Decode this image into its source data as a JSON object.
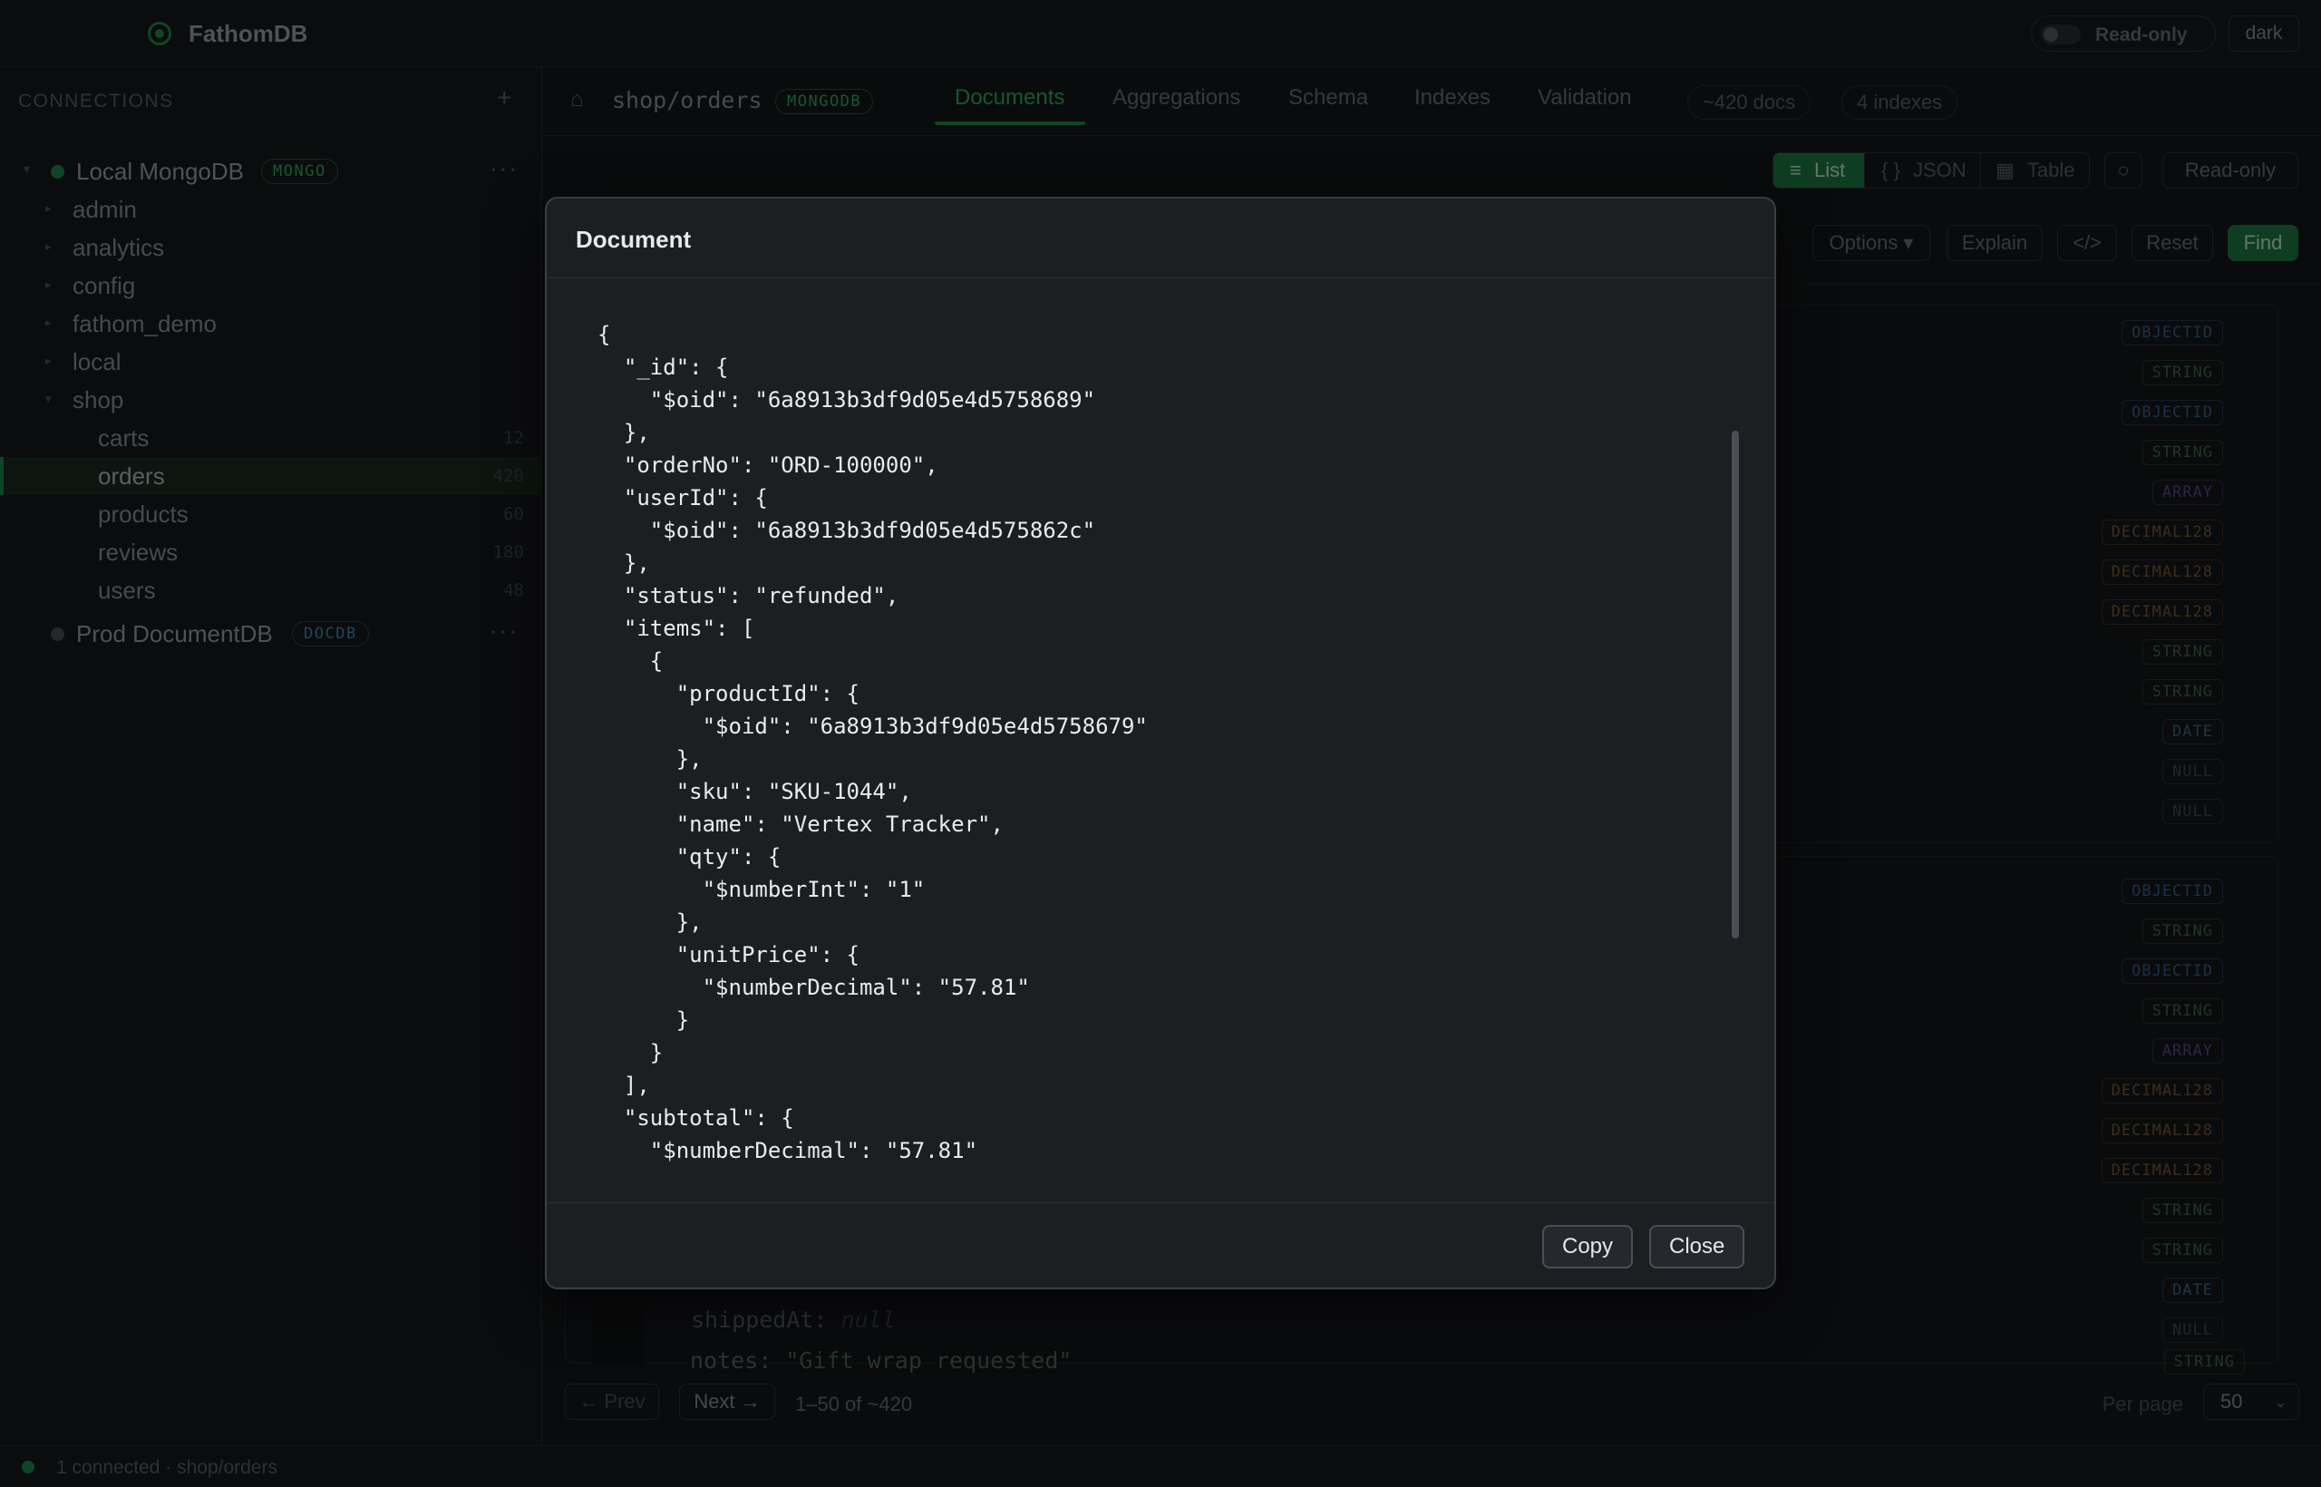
{
  "app": {
    "title": "FathomDB",
    "readonly_toggle": "Read-only",
    "theme": "dark"
  },
  "sidebar": {
    "header": "CONNECTIONS",
    "add": "+",
    "connections": [
      {
        "name": "Local MongoDB",
        "badge": "MONGO",
        "status_color": "#1f8a4c",
        "badge_color": "#2fae5e"
      },
      {
        "name": "Prod DocumentDB",
        "badge": "DOCDB",
        "status_color": "#4b4f55",
        "badge_color": "#3b8fb0"
      }
    ],
    "more": "···",
    "databases": [
      "admin",
      "analytics",
      "config",
      "fathom_demo",
      "local",
      "shop"
    ],
    "collections": [
      {
        "name": "carts",
        "count": "12"
      },
      {
        "name": "orders",
        "count": "420"
      },
      {
        "name": "products",
        "count": "60"
      },
      {
        "name": "reviews",
        "count": "180"
      },
      {
        "name": "users",
        "count": "48"
      }
    ]
  },
  "main": {
    "breadcrumb": "shop/orders",
    "engine_badge": "MONGODB",
    "tabs": [
      "Documents",
      "Aggregations",
      "Schema",
      "Indexes",
      "Validation"
    ],
    "doc_count": "~420 docs",
    "index_count": "4 indexes",
    "view_modes": [
      "List",
      "JSON",
      "Table"
    ],
    "view_icons": {
      "list": "≡",
      "json": "{ }",
      "table": "▦"
    },
    "refresh": "○",
    "readonly_btn": "Read-only",
    "query_buttons": {
      "options": "Options ▾",
      "explain": "Explain",
      "code": "</>",
      "reset": "Reset",
      "find": "Find"
    },
    "type_tags_card1": [
      "OBJECTID",
      "STRING",
      "OBJECTID",
      "STRING",
      "ARRAY",
      "DECIMAL128",
      "DECIMAL128",
      "DECIMAL128",
      "STRING",
      "STRING",
      "DATE",
      "NULL",
      "NULL"
    ],
    "type_tags_card2": [
      "OBJECTID",
      "STRING",
      "OBJECTID",
      "STRING",
      "ARRAY",
      "DECIMAL128",
      "DECIMAL128",
      "DECIMAL128",
      "STRING",
      "STRING",
      "DATE",
      "NULL",
      "STRING"
    ],
    "visible_fields": [
      {
        "key": "shippedAt: ",
        "value": "null"
      },
      {
        "key": "notes: ",
        "value": "\"Gift wrap requested\""
      }
    ],
    "pager": {
      "prev": "← Prev",
      "next": "Next →",
      "range": "1–50 of ~420",
      "per_page_label": "Per page",
      "per_page": "50"
    }
  },
  "status": {
    "text": "1 connected · shop/orders"
  },
  "modal": {
    "title": "Document",
    "json_text": "{\n  \"_id\": {\n    \"$oid\": \"6a8913b3df9d05e4d5758689\"\n  },\n  \"orderNo\": \"ORD-100000\",\n  \"userId\": {\n    \"$oid\": \"6a8913b3df9d05e4d575862c\"\n  },\n  \"status\": \"refunded\",\n  \"items\": [\n    {\n      \"productId\": {\n        \"$oid\": \"6a8913b3df9d05e4d5758679\"\n      },\n      \"sku\": \"SKU-1044\",\n      \"name\": \"Vertex Tracker\",\n      \"qty\": {\n        \"$numberInt\": \"1\"\n      },\n      \"unitPrice\": {\n        \"$numberDecimal\": \"57.81\"\n      }\n    }\n  ],\n  \"subtotal\": {\n    \"$numberDecimal\": \"57.81\"",
    "copy": "Copy",
    "close": "Close"
  }
}
